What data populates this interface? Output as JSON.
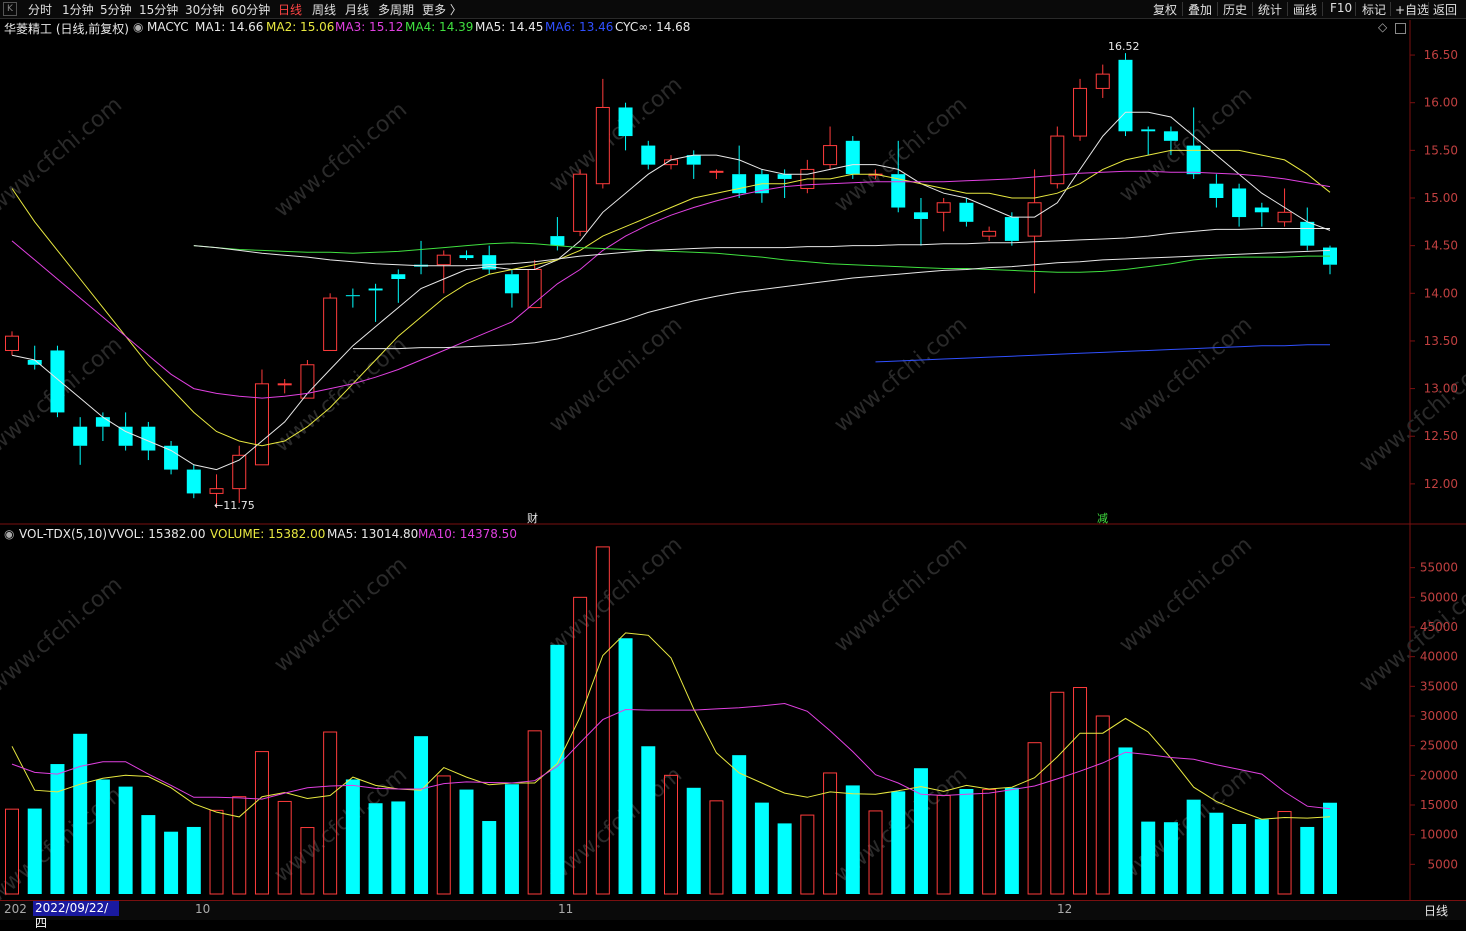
{
  "toolbar": {
    "timeframes": [
      "分时",
      "1分钟",
      "5分钟",
      "15分钟",
      "30分钟",
      "60分钟",
      "日线",
      "周线",
      "月线",
      "多周期",
      "更多 〉"
    ],
    "active_timeframe": "日线",
    "right_items": [
      "复权",
      "叠加",
      "历史",
      "统计",
      "画线",
      "F10",
      "标记",
      "+自选",
      "返回"
    ]
  },
  "indicator": {
    "stock": "华菱精工 (日线,前复权)",
    "name": "MACYC",
    "items": [
      {
        "label": "MA1: 14.66",
        "color": "#e8e8e8"
      },
      {
        "label": "MA2: 15.06",
        "color": "#e8e840"
      },
      {
        "label": "MA3: 15.12",
        "color": "#e040e0"
      },
      {
        "label": "MA4: 14.39",
        "color": "#40e040"
      },
      {
        "label": "MA5: 14.45",
        "color": "#e8e8e8"
      },
      {
        "label": "MA6: 13.46",
        "color": "#3050ff"
      },
      {
        "label": "CYC∞: 14.68",
        "color": "#e8e8e8"
      }
    ]
  },
  "volume_indicator": {
    "name": "VOL-TDX(5,10)",
    "items": [
      {
        "label": "VVOL: 15382.00",
        "color": "#e8e8e8"
      },
      {
        "label": "VOLUME: 15382.00",
        "color": "#e8e840"
      },
      {
        "label": "MA5: 13014.80",
        "color": "#e8e8e8"
      },
      {
        "label": "MA10: 14378.50",
        "color": "#e040e0"
      }
    ]
  },
  "price_axis": [
    "16.50",
    "16.00",
    "15.50",
    "15.00",
    "14.50",
    "14.00",
    "13.50",
    "13.00",
    "12.50",
    "12.00"
  ],
  "volume_axis": [
    "55000",
    "50000",
    "45000",
    "40000",
    "35000",
    "30000",
    "25000",
    "20000",
    "15000",
    "10000",
    "5000"
  ],
  "annotations": {
    "high": "16.52",
    "low": "←11.75",
    "marker1": "财",
    "marker2": "减"
  },
  "date_axis": {
    "labels": [
      "202",
      "10",
      "11",
      "12"
    ],
    "selected_date": "2022/09/22/四"
  },
  "bottom_label": "日线",
  "watermark": "www.cfchi.com",
  "colors": {
    "up": "#ff3c3c",
    "down": "#00ffff",
    "ma1": "#e8e8e8",
    "ma2": "#e8e840",
    "ma3": "#e040e0",
    "ma4": "#40e040",
    "ma6": "#3050ff"
  },
  "chart_data": {
    "type": "candlestick",
    "price_range": [
      11.6,
      16.7
    ],
    "volume_range": [
      0,
      60000
    ],
    "candles": [
      {
        "o": 13.4,
        "c": 13.55,
        "h": 13.6,
        "l": 13.35,
        "v": 14300
      },
      {
        "o": 13.3,
        "c": 13.25,
        "h": 13.45,
        "l": 13.2,
        "v": 14400
      },
      {
        "o": 13.4,
        "c": 12.75,
        "h": 13.45,
        "l": 12.7,
        "v": 21900
      },
      {
        "o": 12.6,
        "c": 12.4,
        "h": 12.7,
        "l": 12.2,
        "v": 27000
      },
      {
        "o": 12.7,
        "c": 12.6,
        "h": 12.75,
        "l": 12.45,
        "v": 19300
      },
      {
        "o": 12.6,
        "c": 12.4,
        "h": 12.75,
        "l": 12.35,
        "v": 18100
      },
      {
        "o": 12.6,
        "c": 12.35,
        "h": 12.65,
        "l": 12.25,
        "v": 13300
      },
      {
        "o": 12.4,
        "c": 12.15,
        "h": 12.45,
        "l": 12.1,
        "v": 10500
      },
      {
        "o": 12.15,
        "c": 11.9,
        "h": 12.2,
        "l": 11.85,
        "v": 11300
      },
      {
        "o": 11.9,
        "c": 11.95,
        "h": 12.1,
        "l": 11.75,
        "v": 14100
      },
      {
        "o": 11.95,
        "c": 12.3,
        "h": 12.4,
        "l": 11.8,
        "v": 16400
      },
      {
        "o": 12.2,
        "c": 13.05,
        "h": 13.2,
        "l": 12.2,
        "v": 24000
      },
      {
        "o": 13.05,
        "c": 13.05,
        "h": 13.1,
        "l": 12.95,
        "v": 15600
      },
      {
        "o": 12.9,
        "c": 13.25,
        "h": 13.3,
        "l": 12.9,
        "v": 11200
      },
      {
        "o": 13.4,
        "c": 13.95,
        "h": 14.0,
        "l": 13.4,
        "v": 27300
      },
      {
        "o": 13.98,
        "c": 13.97,
        "h": 14.05,
        "l": 13.85,
        "v": 19300
      },
      {
        "o": 14.05,
        "c": 14.03,
        "h": 14.1,
        "l": 13.7,
        "v": 15300
      },
      {
        "o": 14.2,
        "c": 14.15,
        "h": 14.25,
        "l": 13.9,
        "v": 15600
      },
      {
        "o": 14.3,
        "c": 14.28,
        "h": 14.55,
        "l": 14.2,
        "v": 26600
      },
      {
        "o": 14.3,
        "c": 14.4,
        "h": 14.45,
        "l": 14.0,
        "v": 19900
      },
      {
        "o": 14.4,
        "c": 14.37,
        "h": 14.45,
        "l": 14.35,
        "v": 17600
      },
      {
        "o": 14.4,
        "c": 14.25,
        "h": 14.5,
        "l": 14.2,
        "v": 12300
      },
      {
        "o": 14.2,
        "c": 14.0,
        "h": 14.25,
        "l": 13.85,
        "v": 18500
      },
      {
        "o": 13.85,
        "c": 14.25,
        "h": 14.35,
        "l": 13.85,
        "v": 27500
      },
      {
        "o": 14.6,
        "c": 14.5,
        "h": 14.8,
        "l": 14.45,
        "v": 42000
      },
      {
        "o": 14.65,
        "c": 15.25,
        "h": 15.3,
        "l": 14.6,
        "v": 50000
      },
      {
        "o": 15.15,
        "c": 15.95,
        "h": 16.25,
        "l": 15.1,
        "v": 58500
      },
      {
        "o": 15.95,
        "c": 15.65,
        "h": 16.0,
        "l": 15.5,
        "v": 43100
      },
      {
        "o": 15.55,
        "c": 15.35,
        "h": 15.6,
        "l": 15.3,
        "v": 24900
      },
      {
        "o": 15.35,
        "c": 15.4,
        "h": 15.45,
        "l": 15.3,
        "v": 20000
      },
      {
        "o": 15.45,
        "c": 15.35,
        "h": 15.5,
        "l": 15.2,
        "v": 17900
      },
      {
        "o": 15.28,
        "c": 15.28,
        "h": 15.3,
        "l": 15.2,
        "v": 15700
      },
      {
        "o": 15.25,
        "c": 15.05,
        "h": 15.55,
        "l": 15.0,
        "v": 23400
      },
      {
        "o": 15.25,
        "c": 15.05,
        "h": 15.3,
        "l": 14.95,
        "v": 15400
      },
      {
        "o": 15.25,
        "c": 15.2,
        "h": 15.3,
        "l": 15.0,
        "v": 11900
      },
      {
        "o": 15.1,
        "c": 15.3,
        "h": 15.4,
        "l": 15.05,
        "v": 13300
      },
      {
        "o": 15.35,
        "c": 15.55,
        "h": 15.75,
        "l": 15.3,
        "v": 20400
      },
      {
        "o": 15.6,
        "c": 15.25,
        "h": 15.65,
        "l": 15.2,
        "v": 18300
      },
      {
        "o": 15.25,
        "c": 15.25,
        "h": 15.3,
        "l": 15.2,
        "v": 14000
      },
      {
        "o": 15.25,
        "c": 14.9,
        "h": 15.6,
        "l": 14.85,
        "v": 17300
      },
      {
        "o": 14.85,
        "c": 14.78,
        "h": 15.0,
        "l": 14.5,
        "v": 21200
      },
      {
        "o": 14.85,
        "c": 14.95,
        "h": 15.0,
        "l": 14.65,
        "v": 16600
      },
      {
        "o": 14.95,
        "c": 14.75,
        "h": 15.0,
        "l": 14.7,
        "v": 17700
      },
      {
        "o": 14.6,
        "c": 14.65,
        "h": 14.7,
        "l": 14.55,
        "v": 17600
      },
      {
        "o": 14.8,
        "c": 14.55,
        "h": 14.85,
        "l": 14.5,
        "v": 17900
      },
      {
        "o": 14.6,
        "c": 14.95,
        "h": 15.3,
        "l": 14.0,
        "v": 25500
      },
      {
        "o": 15.15,
        "c": 15.65,
        "h": 15.75,
        "l": 15.1,
        "v": 34000
      },
      {
        "o": 15.65,
        "c": 16.15,
        "h": 16.25,
        "l": 15.6,
        "v": 34800
      },
      {
        "o": 16.15,
        "c": 16.3,
        "h": 16.4,
        "l": 16.05,
        "v": 30000
      },
      {
        "o": 16.45,
        "c": 15.7,
        "h": 16.52,
        "l": 15.65,
        "v": 24700
      },
      {
        "o": 15.72,
        "c": 15.7,
        "h": 15.75,
        "l": 15.45,
        "v": 12200
      },
      {
        "o": 15.7,
        "c": 15.6,
        "h": 15.75,
        "l": 15.45,
        "v": 12100
      },
      {
        "o": 15.55,
        "c": 15.25,
        "h": 15.95,
        "l": 15.2,
        "v": 15900
      },
      {
        "o": 15.15,
        "c": 15.0,
        "h": 15.25,
        "l": 14.9,
        "v": 13700
      },
      {
        "o": 15.1,
        "c": 14.8,
        "h": 15.15,
        "l": 14.7,
        "v": 11800
      },
      {
        "o": 14.9,
        "c": 14.85,
        "h": 14.95,
        "l": 14.7,
        "v": 12600
      },
      {
        "o": 14.75,
        "c": 14.85,
        "h": 15.1,
        "l": 14.7,
        "v": 13900
      },
      {
        "o": 14.75,
        "c": 14.5,
        "h": 14.9,
        "l": 14.45,
        "v": 11300
      },
      {
        "o": 14.48,
        "c": 14.3,
        "h": 14.5,
        "l": 14.2,
        "v": 15382
      }
    ],
    "ma_lines": {
      "ma1": [
        13.35,
        13.3,
        13.1,
        12.9,
        12.7,
        12.55,
        12.45,
        12.35,
        12.2,
        12.15,
        12.25,
        12.45,
        12.65,
        12.95,
        13.2,
        13.45,
        13.65,
        13.85,
        14.05,
        14.15,
        14.25,
        14.28,
        14.25,
        14.25,
        14.35,
        14.55,
        14.85,
        15.05,
        15.25,
        15.4,
        15.45,
        15.45,
        15.4,
        15.3,
        15.25,
        15.25,
        15.3,
        15.35,
        15.35,
        15.3,
        15.15,
        15.05,
        15.0,
        14.9,
        14.8,
        14.8,
        14.95,
        15.3,
        15.65,
        15.9,
        15.9,
        15.85,
        15.65,
        15.45,
        15.25,
        15.05,
        14.9,
        14.75,
        14.66
      ],
      "ma2": [
        15.1,
        14.75,
        14.45,
        14.15,
        13.85,
        13.55,
        13.25,
        13.0,
        12.75,
        12.55,
        12.45,
        12.4,
        12.45,
        12.6,
        12.8,
        13.05,
        13.3,
        13.55,
        13.75,
        13.95,
        14.1,
        14.2,
        14.25,
        14.3,
        14.35,
        14.45,
        14.6,
        14.7,
        14.8,
        14.9,
        15.0,
        15.05,
        15.1,
        15.15,
        15.15,
        15.2,
        15.2,
        15.25,
        15.25,
        15.2,
        15.15,
        15.1,
        15.05,
        15.05,
        15.0,
        15.0,
        15.05,
        15.15,
        15.3,
        15.4,
        15.45,
        15.5,
        15.5,
        15.5,
        15.5,
        15.45,
        15.4,
        15.25,
        15.06
      ],
      "ma3": [
        14.55,
        14.35,
        14.15,
        13.95,
        13.75,
        13.55,
        13.35,
        13.15,
        13.0,
        12.95,
        12.92,
        12.9,
        12.92,
        12.95,
        13.0,
        13.05,
        13.12,
        13.2,
        13.3,
        13.4,
        13.5,
        13.6,
        13.7,
        13.9,
        14.1,
        14.25,
        14.45,
        14.6,
        14.72,
        14.82,
        14.9,
        14.97,
        15.03,
        15.08,
        15.12,
        15.14,
        15.15,
        15.16,
        15.17,
        15.17,
        15.17,
        15.17,
        15.18,
        15.19,
        15.2,
        15.22,
        15.24,
        15.26,
        15.27,
        15.28,
        15.28,
        15.27,
        15.27,
        15.26,
        15.25,
        15.23,
        15.2,
        15.16,
        15.12
      ],
      "ma4": [
        14.5,
        14.48,
        14.46,
        14.45,
        14.44,
        14.43,
        14.43,
        14.42,
        14.43,
        14.44,
        14.46,
        14.48,
        14.5,
        14.52,
        14.53,
        14.52,
        14.5,
        14.48,
        14.47,
        14.46,
        14.45,
        14.44,
        14.43,
        14.42,
        14.4,
        14.38,
        14.35,
        14.33,
        14.31,
        14.3,
        14.29,
        14.28,
        14.27,
        14.26,
        14.26,
        14.25,
        14.24,
        14.23,
        14.22,
        14.22,
        14.23,
        14.25,
        14.28,
        14.31,
        14.35,
        14.37,
        14.38,
        14.38,
        14.38,
        14.39,
        14.39
      ],
      "ma5": [
        14.5,
        14.48,
        14.45,
        14.42,
        14.4,
        14.38,
        14.35,
        14.33,
        14.31,
        14.3,
        14.29,
        14.29,
        14.29,
        14.3,
        14.31,
        14.33,
        14.36,
        14.39,
        14.41,
        14.43,
        14.45,
        14.46,
        14.47,
        14.48,
        14.48,
        14.48,
        14.48,
        14.49,
        14.49,
        14.5,
        14.5,
        14.51,
        14.51,
        14.52,
        14.52,
        14.53,
        14.53,
        14.54,
        14.55,
        14.56,
        14.57,
        14.58,
        14.6,
        14.63,
        14.65,
        14.67,
        14.67,
        14.68,
        14.68,
        14.68,
        14.68
      ],
      "ma_white_long": [
        13.42,
        13.42,
        13.42,
        13.43,
        13.43,
        13.44,
        13.45,
        13.46,
        13.48,
        13.52,
        13.58,
        13.65,
        13.72,
        13.8,
        13.86,
        13.92,
        13.97,
        14.01,
        14.04,
        14.07,
        14.1,
        14.13,
        14.16,
        14.18,
        14.2,
        14.22,
        14.24,
        14.25,
        14.27,
        14.28,
        14.3,
        14.32,
        14.33,
        14.35,
        14.36,
        14.37,
        14.38,
        14.39,
        14.4,
        14.41,
        14.42,
        14.43,
        14.44,
        14.45
      ],
      "ma6": [
        13.28,
        13.29,
        13.3,
        13.31,
        13.32,
        13.33,
        13.34,
        13.35,
        13.36,
        13.37,
        13.38,
        13.39,
        13.4,
        13.41,
        13.42,
        13.43,
        13.44,
        13.45,
        13.45,
        13.46,
        13.46
      ]
    },
    "vol_ma5": [
      24900,
      17500,
      17200,
      18500,
      19500,
      20000,
      19800,
      17900,
      15200,
      13800,
      13000,
      16400,
      17100,
      16100,
      16600,
      19700,
      18300,
      17700,
      17500,
      21300,
      19700,
      18400,
      18700,
      18700,
      22000,
      29800,
      40200,
      44000,
      43600,
      39800,
      31200,
      23800,
      20400,
      18700,
      17000,
      16300,
      17200,
      16900,
      16800,
      17400,
      18100,
      17300,
      18300,
      17700,
      18000,
      19600,
      23100,
      27100,
      27100,
      29600,
      27300,
      22900,
      18000,
      15600,
      14000,
      12600,
      12900,
      12800,
      13015
    ],
    "vol_ma10": [
      21900,
      20500,
      20200,
      21500,
      22300,
      22300,
      20200,
      18300,
      16300,
      16300,
      16200,
      16000,
      17000,
      17900,
      18200,
      18300,
      17800,
      17700,
      17700,
      18600,
      18900,
      18800,
      18700,
      19100,
      21500,
      25500,
      29400,
      31100,
      31000,
      31000,
      31000,
      31200,
      31400,
      31700,
      32100,
      30800,
      27500,
      24000,
      20100,
      18700,
      16800,
      16600,
      16800,
      17000,
      17600,
      18200,
      19400,
      20700,
      22100,
      23900,
      23500,
      23000,
      22700,
      21800,
      21000,
      20200,
      17200,
      14800,
      14378
    ]
  }
}
